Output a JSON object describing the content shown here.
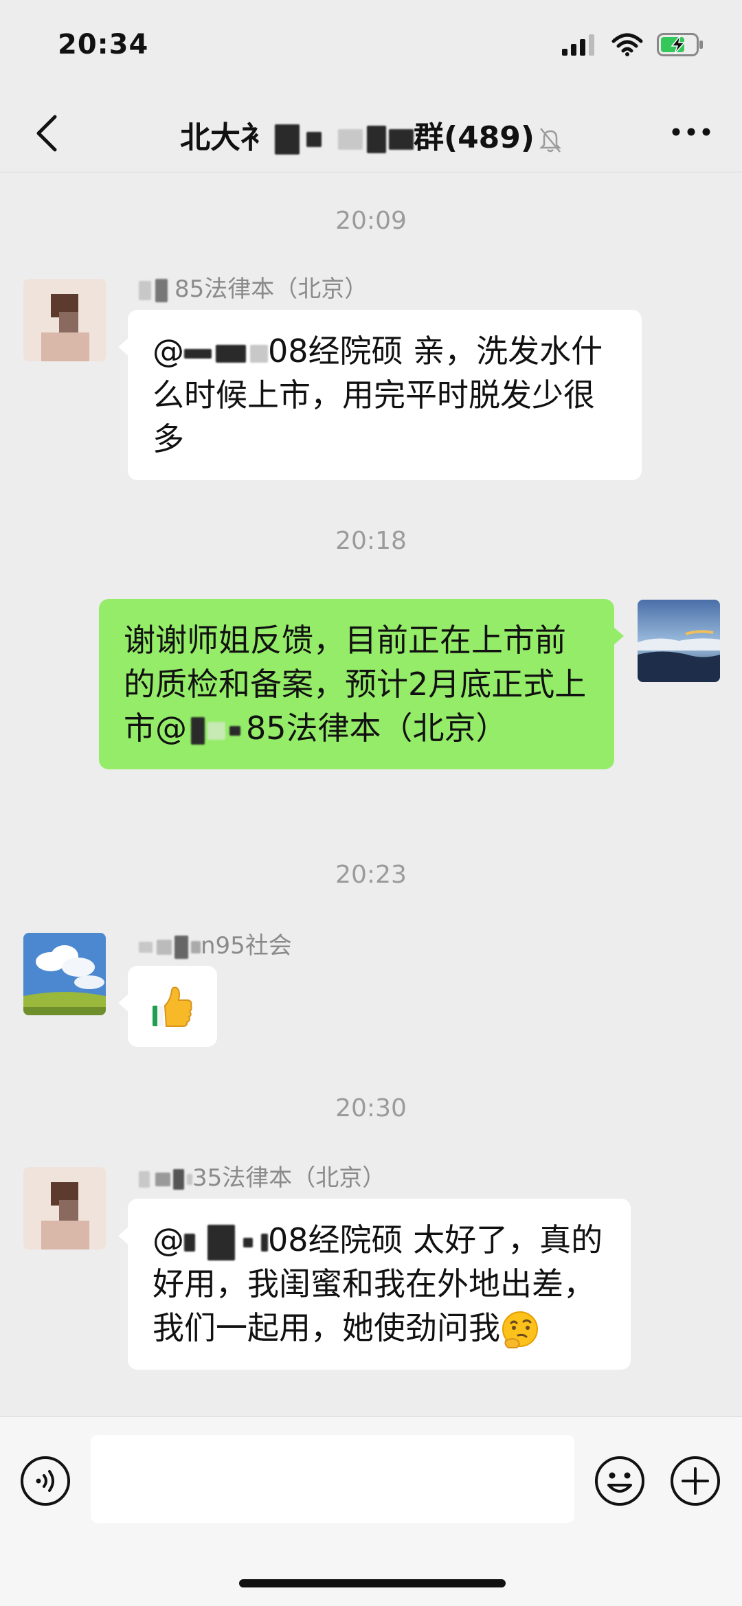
{
  "status_bar": {
    "time": "20:34"
  },
  "header": {
    "title_start": "北大衤",
    "title_end": "群",
    "member_count": "(489)"
  },
  "messages": [
    {
      "timestamp": "20:09",
      "sender_suffix": "85法律本（北京）",
      "mention_prefix": "@",
      "mention_suffix": "08经院硕",
      "text": " 亲，洗发水什么时候上市，用完平时脱发少很多"
    },
    {
      "timestamp": "20:18",
      "text": "谢谢师姐反馈，目前正在上市前的质检和备案，预计2月底正式上市@",
      "mention_suffix": "85法律本（北京）"
    },
    {
      "timestamp": "20:23",
      "sender_suffix": "n95社会",
      "emoji": "thumbs-up"
    },
    {
      "timestamp": "20:30",
      "sender_suffix": "35法律本（北京）",
      "mention_prefix": "@",
      "mention_suffix": "08经院硕",
      "text": " 太好了，真的好用，我闺蜜和我在外地出差，我们一起用，她使劲问我"
    }
  ],
  "colors": {
    "background": "#ededed",
    "my_bubble": "#95ec69",
    "their_bubble": "#ffffff",
    "timestamp": "#9b9b9b"
  },
  "input_bar": {
    "placeholder": ""
  }
}
